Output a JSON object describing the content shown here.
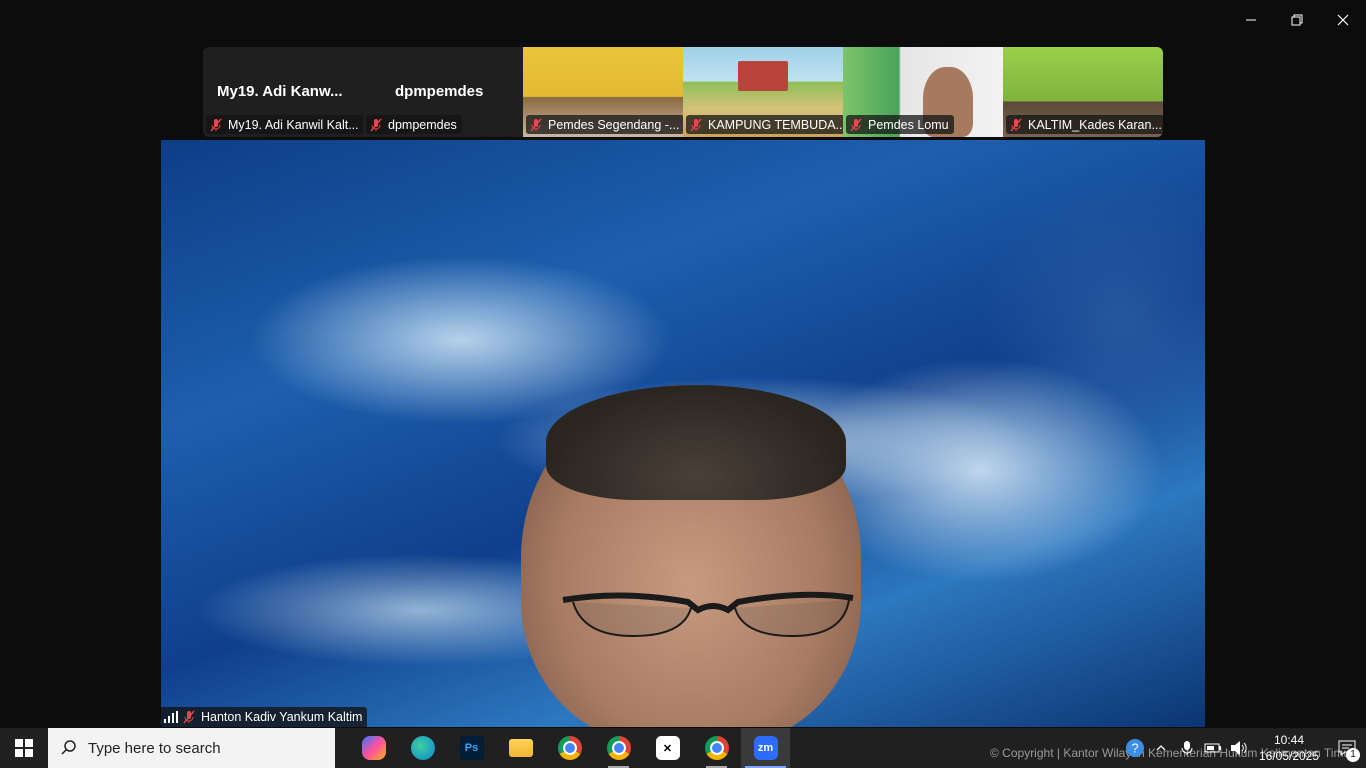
{
  "window_controls": {
    "minimize": "minimize",
    "restore": "restore",
    "close": "close"
  },
  "participants": [
    {
      "display_name": "My19. Adi Kanw...",
      "label": "My19. Adi Kanwil Kalt...",
      "muted": true,
      "video": false
    },
    {
      "display_name": "dpmpemdes",
      "label": "dpmpemdes",
      "muted": true,
      "video": false
    },
    {
      "label": "Pemdes Segendang -...",
      "muted": true,
      "video": true
    },
    {
      "label": "KAMPUNG TEMBUDA...",
      "muted": true,
      "video": true
    },
    {
      "label": "Pemdes Lomu",
      "muted": true,
      "video": true
    },
    {
      "label": "KALTIM_Kades Karan...",
      "muted": true,
      "video": true
    }
  ],
  "main_speaker": {
    "label": "Hanton Kadiv Yankum Kaltim",
    "muted": true
  },
  "taskbar": {
    "search_placeholder": "Type here to search",
    "apps": [
      {
        "name": "Copilot",
        "icon": "copilot-icon"
      },
      {
        "name": "Microsoft Edge",
        "icon": "edge-icon"
      },
      {
        "name": "Photoshop",
        "icon": "photoshop-icon",
        "text": "Ps"
      },
      {
        "name": "File Explorer",
        "icon": "folder-icon"
      },
      {
        "name": "Google Chrome",
        "icon": "chrome-icon"
      },
      {
        "name": "Google Chrome profile",
        "icon": "chrome-profile-icon"
      },
      {
        "name": "CapCut",
        "icon": "capcut-icon"
      },
      {
        "name": "Google Chrome profile 2",
        "icon": "chrome-profile2-icon"
      },
      {
        "name": "Zoom",
        "icon": "zoom-icon",
        "text": "zm"
      }
    ],
    "copyright": "© Copyright | Kantor Wilayah Kementerian Hukum Kalimantan Timur",
    "time": "10:44",
    "date": "16/05/2025",
    "notification_count": "1"
  },
  "colors": {
    "muted_red": "#e5484d",
    "taskbar_bg": "#202020",
    "zoom_blue": "#2d6cff"
  }
}
